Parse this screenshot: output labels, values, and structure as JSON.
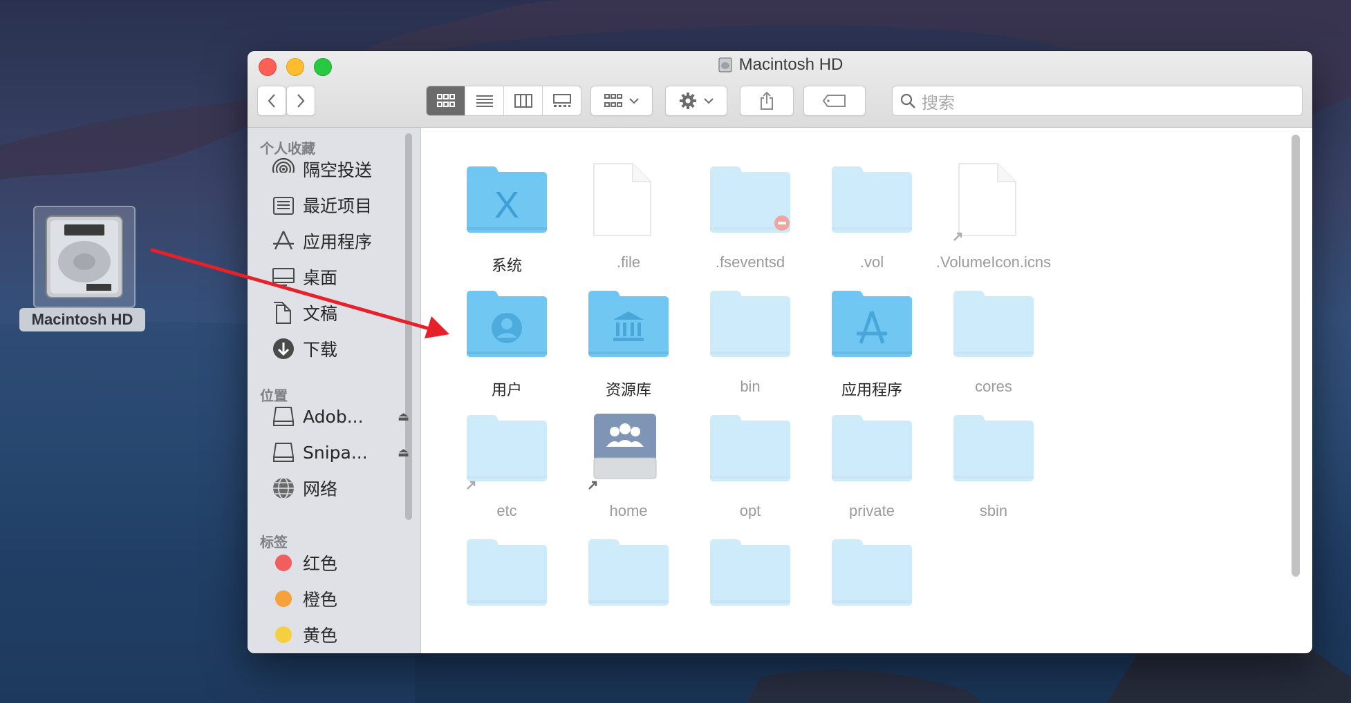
{
  "desktop": {
    "drive_label": "Macintosh HD"
  },
  "window": {
    "title": "Macintosh HD",
    "search_placeholder": "搜索"
  },
  "sidebar": {
    "favorites_header": "个人收藏",
    "favorites": [
      {
        "label": "隔空投送",
        "icon": "airdrop-icon"
      },
      {
        "label": "最近项目",
        "icon": "recents-icon"
      },
      {
        "label": "应用程序",
        "icon": "applications-icon"
      },
      {
        "label": "桌面",
        "icon": "desktop-icon"
      },
      {
        "label": "文稿",
        "icon": "documents-icon"
      },
      {
        "label": "下载",
        "icon": "downloads-icon"
      }
    ],
    "locations_header": "位置",
    "locations": [
      {
        "label": "Adob...",
        "icon": "drive-icon"
      },
      {
        "label": "Snipa...",
        "icon": "drive-icon"
      },
      {
        "label": "网络",
        "icon": "network-icon"
      }
    ],
    "tags_header": "标签",
    "tags": [
      {
        "label": "红色",
        "color": "#f25d5d"
      },
      {
        "label": "橙色",
        "color": "#f6a23c"
      },
      {
        "label": "黄色",
        "color": "#f6cf3c"
      }
    ]
  },
  "content": {
    "items": [
      {
        "label": "系统",
        "kind": "folder-system"
      },
      {
        "label": ".file",
        "kind": "file"
      },
      {
        "label": ".fseventsd",
        "kind": "folder-restricted"
      },
      {
        "label": ".vol",
        "kind": "folder"
      },
      {
        "label": ".VolumeIcon.icns",
        "kind": "file-alias"
      },
      {
        "label": "用户",
        "kind": "folder-users"
      },
      {
        "label": "资源库",
        "kind": "folder-library"
      },
      {
        "label": "bin",
        "kind": "folder"
      },
      {
        "label": "应用程序",
        "kind": "folder-apps"
      },
      {
        "label": "cores",
        "kind": "folder"
      },
      {
        "label": "etc",
        "kind": "folder-alias"
      },
      {
        "label": "home",
        "kind": "server-alias"
      },
      {
        "label": "opt",
        "kind": "folder"
      },
      {
        "label": "private",
        "kind": "folder"
      },
      {
        "label": "sbin",
        "kind": "folder"
      }
    ]
  },
  "colors": {
    "folder": "#6fc6f2",
    "folder_light": "#a7dcf7",
    "arrow": "#e8202a"
  }
}
